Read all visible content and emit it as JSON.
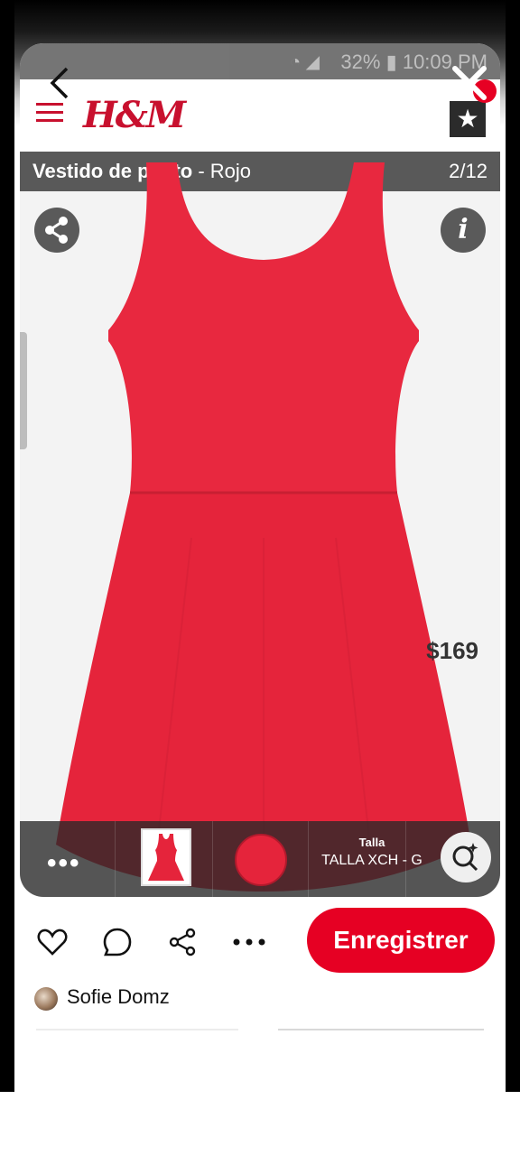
{
  "status_bar": {
    "battery": "32%",
    "time": "10:09 PM"
  },
  "header": {
    "brand_logo": "H&M",
    "menu_icon": "hamburger-icon",
    "star_icon": "star-icon"
  },
  "product": {
    "name": "Vestido de punto",
    "separator": " - ",
    "color": "Rojo",
    "image_counter": "2/12",
    "price": "$169",
    "thumbnail_icon": "dress-thumbnail",
    "color_swatch": "#e5243b",
    "size_label": "Talla",
    "size_value": "TALLA XCH - G"
  },
  "overlay": {
    "back_icon": "chevron-left-icon",
    "close_icon": "close-icon",
    "share_icon": "share-icon",
    "info_icon": "info-icon",
    "lens_icon": "visual-search-icon"
  },
  "actions": {
    "like_icon": "heart-icon",
    "comment_icon": "comment-icon",
    "share_icon": "share-icon",
    "more_icon": "more-icon",
    "save_label": "Enregistrer"
  },
  "user": {
    "name": "Sofie Domz"
  },
  "colors": {
    "brand_red": "#e60023",
    "hm_red": "#c8102e",
    "dress_red": "#e5243b"
  }
}
